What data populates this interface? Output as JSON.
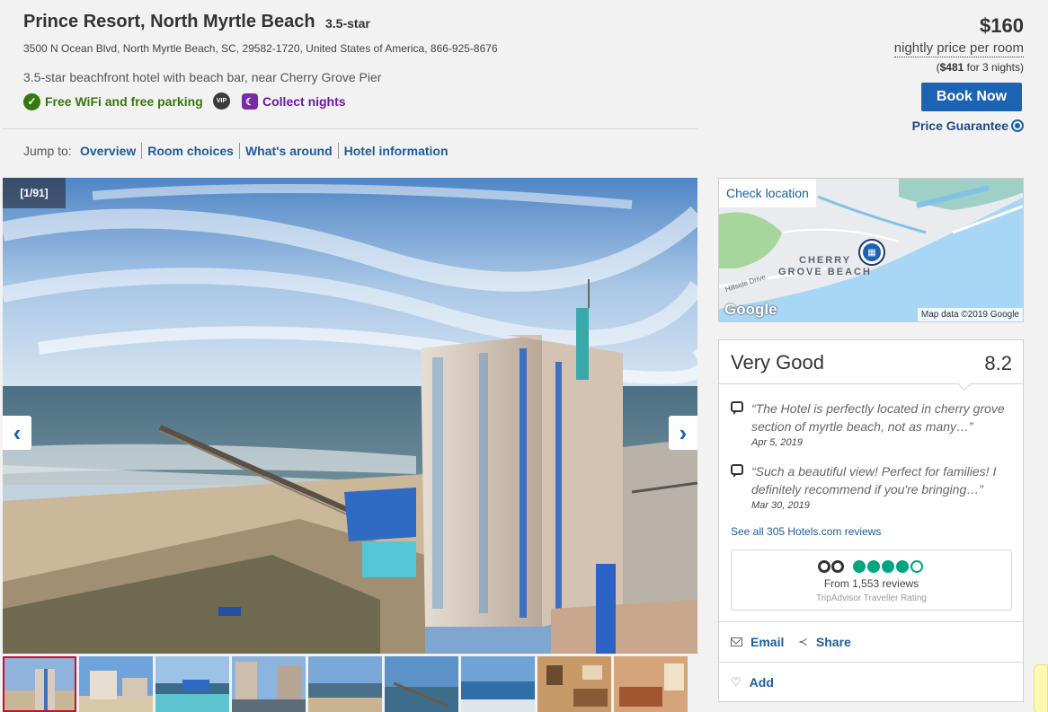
{
  "hotel": {
    "name": "Prince Resort, North Myrtle Beach",
    "star_rating": "3.5-star",
    "address": "3500 N Ocean Blvd, North Myrtle Beach, SC, 29582-1720, United States of America, 866-925-8676",
    "tagline": "3.5-star beachfront hotel with beach bar, near Cherry Grove Pier"
  },
  "amenities": {
    "wifi_label": "Free WiFi and free parking",
    "vip_label": "VIP",
    "rewards_label": "Collect nights"
  },
  "jump": {
    "label": "Jump to:",
    "links": [
      "Overview",
      "Room choices",
      "What's around",
      "Hotel information"
    ]
  },
  "pricing": {
    "price": "$160",
    "price_label": "nightly price per room",
    "total_prefix": "(",
    "total_amount": "$481",
    "total_suffix": " for 3 nights)",
    "book_label": "Book Now",
    "guarantee_label": "Price Guarantee"
  },
  "gallery": {
    "counter": "[1/91]",
    "prev_icon": "‹",
    "next_icon": "›",
    "thumbnail_count": 9
  },
  "map": {
    "check_location": "Check location",
    "area_line_1": "CHERRY",
    "area_line_2": "GROVE BEACH",
    "road_label": "Hillside Drive",
    "logo": "Google",
    "attribution": "Map data ©2019 Google"
  },
  "reviews": {
    "heading": "Very Good",
    "score": "8.2",
    "items": [
      {
        "text": "“The Hotel is perfectly located in cherry grove section of myrtle beach, not as many…”",
        "date": "Apr 5, 2019"
      },
      {
        "text": "“Such a beautiful view! Perfect for families! I definitely recommend if you're bringing…”",
        "date": "Mar 30, 2019"
      }
    ],
    "see_all": "See all 305 Hotels.com reviews",
    "tripadvisor": {
      "rating": 4.5,
      "count_text": "From 1,553 reviews",
      "caption": "TripAdvisor Traveller Rating"
    }
  },
  "actions": {
    "email": "Email",
    "share": "Share",
    "add": "Add"
  },
  "colors": {
    "link": "#1d5c9c",
    "button": "#1d63b4",
    "amenity_green": "#35780d",
    "rewards_purple": "#6a1b9a",
    "tripadvisor_green": "#00a680"
  }
}
